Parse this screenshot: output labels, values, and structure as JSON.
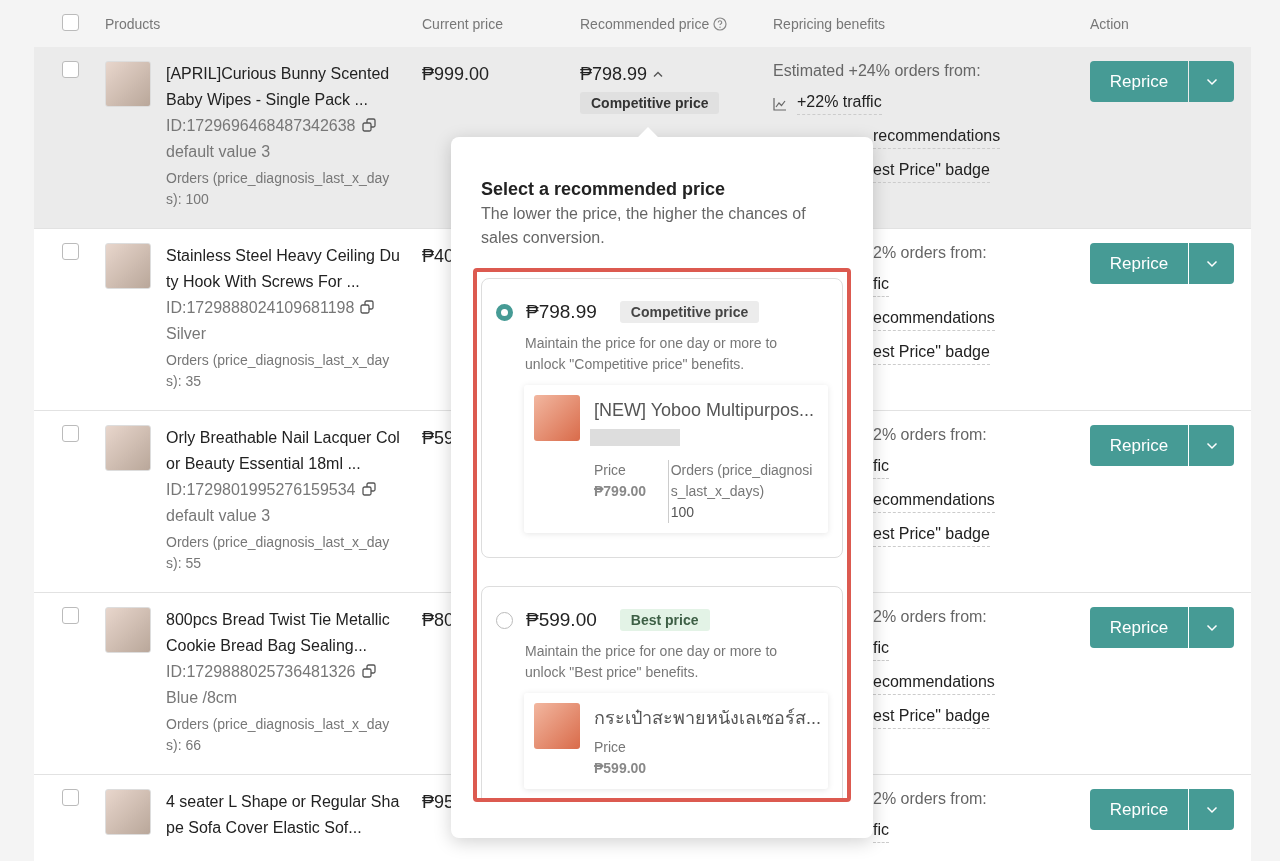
{
  "table": {
    "header_checked": false,
    "columns": [
      "Products",
      "Current price",
      "Recommended price",
      "Repricing benefits",
      "Action"
    ]
  },
  "rows": [
    {
      "highlighted": true,
      "checked": false,
      "name": "[APRIL]Curious Bunny Scented Baby Wipes - Single Pack ...",
      "id": "ID:1729696468487342638",
      "variant": "default value 3",
      "orders": "Orders (price_diagnosis_last_x_days): 100",
      "current_price": "₱999.00",
      "recommended": {
        "price": "₱798.99",
        "expanded": true,
        "tag": "Competitive price"
      },
      "benefits": [
        {
          "kind": "headline",
          "text": "Estimated +24% orders from:"
        },
        {
          "kind": "benefit",
          "text": "+22% traffic"
        },
        {
          "kind": "clipped",
          "text": "recommendations"
        },
        {
          "kind": "clipped",
          "text": "est Price\" badge"
        }
      ],
      "action": "Reprice"
    },
    {
      "highlighted": false,
      "checked": false,
      "name": "Stainless Steel Heavy Ceiling Duty Hook With Screws For ...",
      "id": "ID:1729888024109681198",
      "variant": "Silver",
      "orders": "Orders (price_diagnosis_last_x_days): 35",
      "current_price": "₱40",
      "benefits": [
        {
          "kind": "clipped-headline",
          "text": "2% orders from:"
        },
        {
          "kind": "clipped",
          "text": "fic"
        },
        {
          "kind": "clipped",
          "text": "ecommendations"
        },
        {
          "kind": "clipped",
          "text": "est Price\" badge"
        }
      ],
      "action": "Reprice"
    },
    {
      "highlighted": false,
      "checked": false,
      "name": "Orly Breathable Nail Lacquer Color Beauty Essential 18ml ...",
      "id": "ID:1729801995276159534",
      "variant": "default value 3",
      "orders": "Orders (price_diagnosis_last_x_days): 55",
      "current_price": "₱59",
      "benefits": [
        {
          "kind": "clipped-headline",
          "text": "2% orders from:"
        },
        {
          "kind": "clipped",
          "text": "fic"
        },
        {
          "kind": "clipped",
          "text": "ecommendations"
        },
        {
          "kind": "clipped",
          "text": "est Price\" badge"
        }
      ],
      "action": "Reprice"
    },
    {
      "highlighted": false,
      "checked": false,
      "name": "800pcs Bread Twist Tie Metallic Cookie Bread Bag Sealing...",
      "id": "ID:1729888025736481326",
      "variant": "Blue /8cm",
      "orders": "Orders (price_diagnosis_last_x_days): 66",
      "current_price": "₱80",
      "benefits": [
        {
          "kind": "clipped-headline",
          "text": "2% orders from:"
        },
        {
          "kind": "clipped",
          "text": "fic"
        },
        {
          "kind": "clipped",
          "text": "ecommendations"
        },
        {
          "kind": "clipped",
          "text": "est Price\" badge"
        }
      ],
      "action": "Reprice"
    },
    {
      "highlighted": false,
      "checked": false,
      "name": "4 seater L Shape or Regular Shape Sofa Cover Elastic Sof...",
      "current_price": "₱95",
      "benefits": [
        {
          "kind": "clipped-headline",
          "text": "2% orders from:"
        },
        {
          "kind": "clipped",
          "text": "fic"
        }
      ],
      "action": "Reprice"
    }
  ],
  "popover": {
    "title": "Select a recommended price",
    "subtitle": "The lower the price, the higher the chances of sales conversion.",
    "options": [
      {
        "selected": true,
        "price": "₱798.99",
        "tag": "Competitive price",
        "kind": "competitive",
        "description": "Maintain the price for one day or more to unlock \"Competitive price\" benefits.",
        "product": {
          "name": "[NEW] Yoboo Multipurpos...",
          "price_label": "Price",
          "price": "₱799.00",
          "orders_label": "Orders (price_diagnosis_last_x_days)",
          "orders": "100"
        }
      },
      {
        "selected": false,
        "price": "₱599.00",
        "tag": "Best price",
        "kind": "best",
        "description": "Maintain the price for one day or more to unlock \"Best price\" benefits.",
        "product": {
          "name": "กระเป๋าสะพายหนังเลเซอร์ส...",
          "price_label": "Price",
          "price": "₱599.00"
        }
      }
    ]
  }
}
